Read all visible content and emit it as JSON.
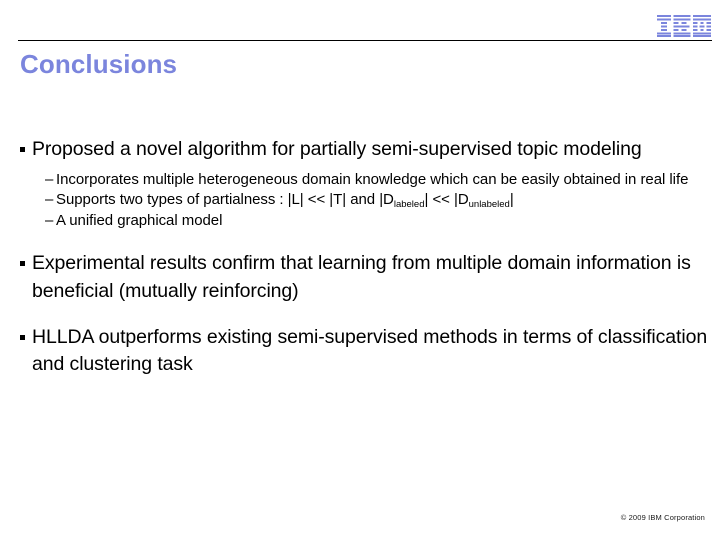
{
  "header": {
    "logo_name": "ibm-logo",
    "logo_alt": "IBM",
    "accent_color": "#7b85dd",
    "rule_color": "#000000"
  },
  "title": "Conclusions",
  "body": {
    "bullets": [
      {
        "level": 1,
        "marker": "square-bullet",
        "text": "Proposed a novel algorithm for partially semi-supervised topic modeling"
      },
      {
        "level": 2,
        "marker": "dash-bullet",
        "text": "Incorporates multiple heterogeneous domain knowledge which can be easily obtained in real life"
      },
      {
        "level": 2,
        "marker": "dash-bullet",
        "rich": true,
        "parts": [
          {
            "type": "text",
            "value": "Supports two types of partialness : |L| << |T|  and |D"
          },
          {
            "type": "sub",
            "value": "labeled"
          },
          {
            "type": "text",
            "value": "| << |D"
          },
          {
            "type": "sub",
            "value": "unlabeled"
          },
          {
            "type": "text",
            "value": "|"
          }
        ],
        "text": "Supports two types of partialness : |L| << |T|  and |Dlabeled| << |Dunlabeled|"
      },
      {
        "level": 2,
        "marker": "dash-bullet",
        "text": "A unified graphical model"
      },
      {
        "level": 1,
        "marker": "square-bullet",
        "text": "Experimental results confirm that learning from multiple domain information is beneficial (mutually reinforcing)"
      },
      {
        "level": 1,
        "marker": "square-bullet",
        "text": "HLLDA outperforms existing semi-supervised methods in terms of classification and clustering task"
      }
    ],
    "dash_marker": "–"
  },
  "footer": {
    "copyright": "© 2009 IBM Corporation"
  }
}
